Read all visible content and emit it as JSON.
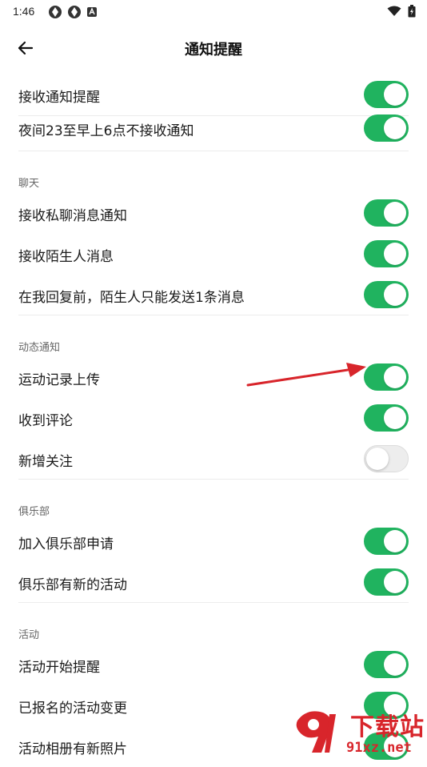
{
  "status_bar": {
    "time": "1:46"
  },
  "header": {
    "title": "通知提醒"
  },
  "groups": [
    {
      "header": null,
      "items": [
        {
          "label": "接收通知提醒",
          "enabled": true
        },
        {
          "label": "夜间23至早上6点不接收通知",
          "enabled": true
        }
      ]
    },
    {
      "header": "聊天",
      "items": [
        {
          "label": "接收私聊消息通知",
          "enabled": true
        },
        {
          "label": "接收陌生人消息",
          "enabled": true
        },
        {
          "label": "在我回复前，陌生人只能发送1条消息",
          "enabled": true
        }
      ]
    },
    {
      "header": "动态通知",
      "items": [
        {
          "label": "运动记录上传",
          "enabled": true
        },
        {
          "label": "收到评论",
          "enabled": true
        },
        {
          "label": "新增关注",
          "enabled": false
        }
      ]
    },
    {
      "header": "俱乐部",
      "items": [
        {
          "label": "加入俱乐部申请",
          "enabled": true
        },
        {
          "label": "俱乐部有新的活动",
          "enabled": true
        }
      ]
    },
    {
      "header": "活动",
      "items": [
        {
          "label": "活动开始提醒",
          "enabled": true
        },
        {
          "label": "已报名的活动变更",
          "enabled": true
        },
        {
          "label": "活动相册有新照片",
          "enabled": true
        }
      ]
    }
  ],
  "watermark": {
    "line1": "下载站",
    "line2": "91xz.net"
  },
  "colors": {
    "toggle_on": "#20b35f",
    "toggle_off": "#ededed",
    "annotation_arrow": "#d8252b"
  }
}
